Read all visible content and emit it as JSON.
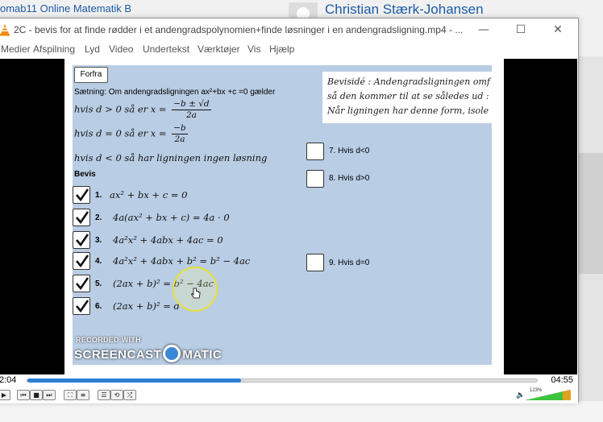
{
  "background": {
    "course_title": "omab11 Online Matematik B",
    "author_name": "Christian Stærk-Johansen"
  },
  "window": {
    "title": "2C - bevis for at finde rødder i et andengradspolynomien+finde løsninger i en andengradsligning.mp4 - ...",
    "minimize": "—",
    "maximize": "☐",
    "close": "✕"
  },
  "menu": [
    "Medier",
    "Afspilning",
    "Lyd",
    "Video",
    "Undertekst",
    "Værktøjer",
    "Vis",
    "Hjælp"
  ],
  "slide": {
    "button_restart": "Forfra",
    "theorem": "Sætning: Om andengradsligningen ax²+bx +c =0 gælder",
    "cond1_prefix": "hvis  d > 0  så er x =",
    "cond1_num": "−b ± √d",
    "cond1_den": "2a",
    "cond2_prefix": "hvis  d = 0  så er x =",
    "cond2_num": "−b",
    "cond2_den": "2a",
    "cond3": "hvis d < 0 så har ligningen ingen løsning",
    "proof_heading": "Bevis",
    "steps": [
      {
        "num": "1.",
        "eq": "ax² + bx + c = 0",
        "checked": true
      },
      {
        "num": "2.",
        "eq": "4a(ax² + bx + c) = 4a · 0",
        "checked": true
      },
      {
        "num": "3.",
        "eq": "4a²x² + 4abx + 4ac = 0",
        "checked": true
      },
      {
        "num": "4.",
        "eq": "4a²x² + 4abx + b² = b² − 4ac",
        "checked": true
      },
      {
        "num": "5.",
        "eq": "(2ax + b)² = b² − 4ac",
        "checked": true
      },
      {
        "num": "6.",
        "eq": "(2ax + b)² = d",
        "checked": true
      }
    ],
    "cases": [
      {
        "label": "7. Hvis d<0",
        "checked": false
      },
      {
        "label": "8. Hvis d>0",
        "checked": false
      },
      {
        "label": "9. Hvis d=0",
        "checked": false
      }
    ],
    "aside_lines": [
      "Bevisidé : Andengradsligningen omf",
      "så den kommer til at se således ud : (",
      "Når ligningen har denne form, isole"
    ]
  },
  "watermark": {
    "recorded": "RECORDED WITH",
    "brand_left": "SCREENCAST",
    "brand_right": "MATIC"
  },
  "controls": {
    "time_current": "2:04",
    "time_total": "04:55",
    "progress_fraction": 0.42,
    "volume_label": "123%",
    "volume_fraction": 1.0
  },
  "colors": {
    "accent": "#2c7fd3",
    "slide_panel": "#b9cde4",
    "link_blue": "#1a5aa8"
  }
}
